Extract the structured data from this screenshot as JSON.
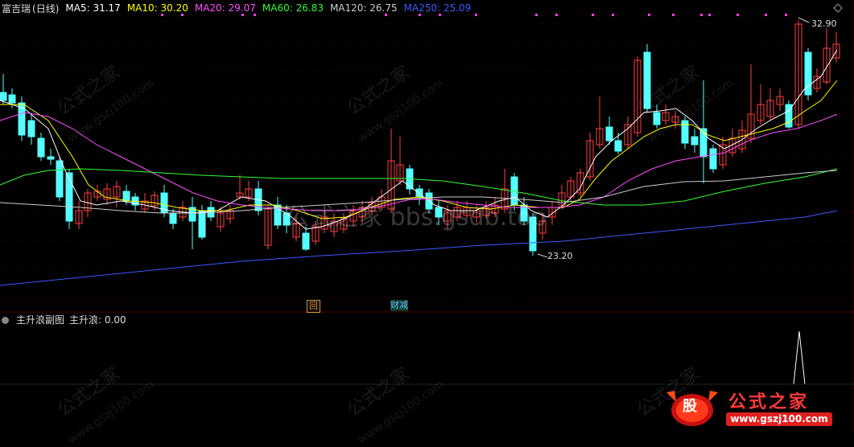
{
  "header": {
    "stock_name": "富吉瑞",
    "period": "(日线)",
    "ma": [
      {
        "label": "MA5: 31.17",
        "color": "#ffffff"
      },
      {
        "label": "MA10: 30.20",
        "color": "#ffff00"
      },
      {
        "label": "MA20: 29.07",
        "color": "#ff4dff"
      },
      {
        "label": "MA60: 26.83",
        "color": "#33ff33"
      },
      {
        "label": "MA120: 26.75",
        "color": "#cccccc"
      },
      {
        "label": "MA250: 25.09",
        "color": "#3b5bff"
      }
    ]
  },
  "annotations": {
    "high": "32.90",
    "low": "23.20",
    "event_box": "回",
    "event_text": "财减"
  },
  "sub_panel": {
    "title": "主升浪副图",
    "value_label": "主升浪: 0.00"
  },
  "watermarks": {
    "brand": "公式之家",
    "url": "www.gszj100.com",
    "center": "公式之家 bbs.gsdb.top"
  },
  "logo": {
    "text": "公式之家",
    "url": "www.gszj100.com",
    "emblem": "股"
  },
  "colors": {
    "up": "#ff4040",
    "down": "#54ffff",
    "background": "#000000",
    "grid": "#3a0000"
  }
}
